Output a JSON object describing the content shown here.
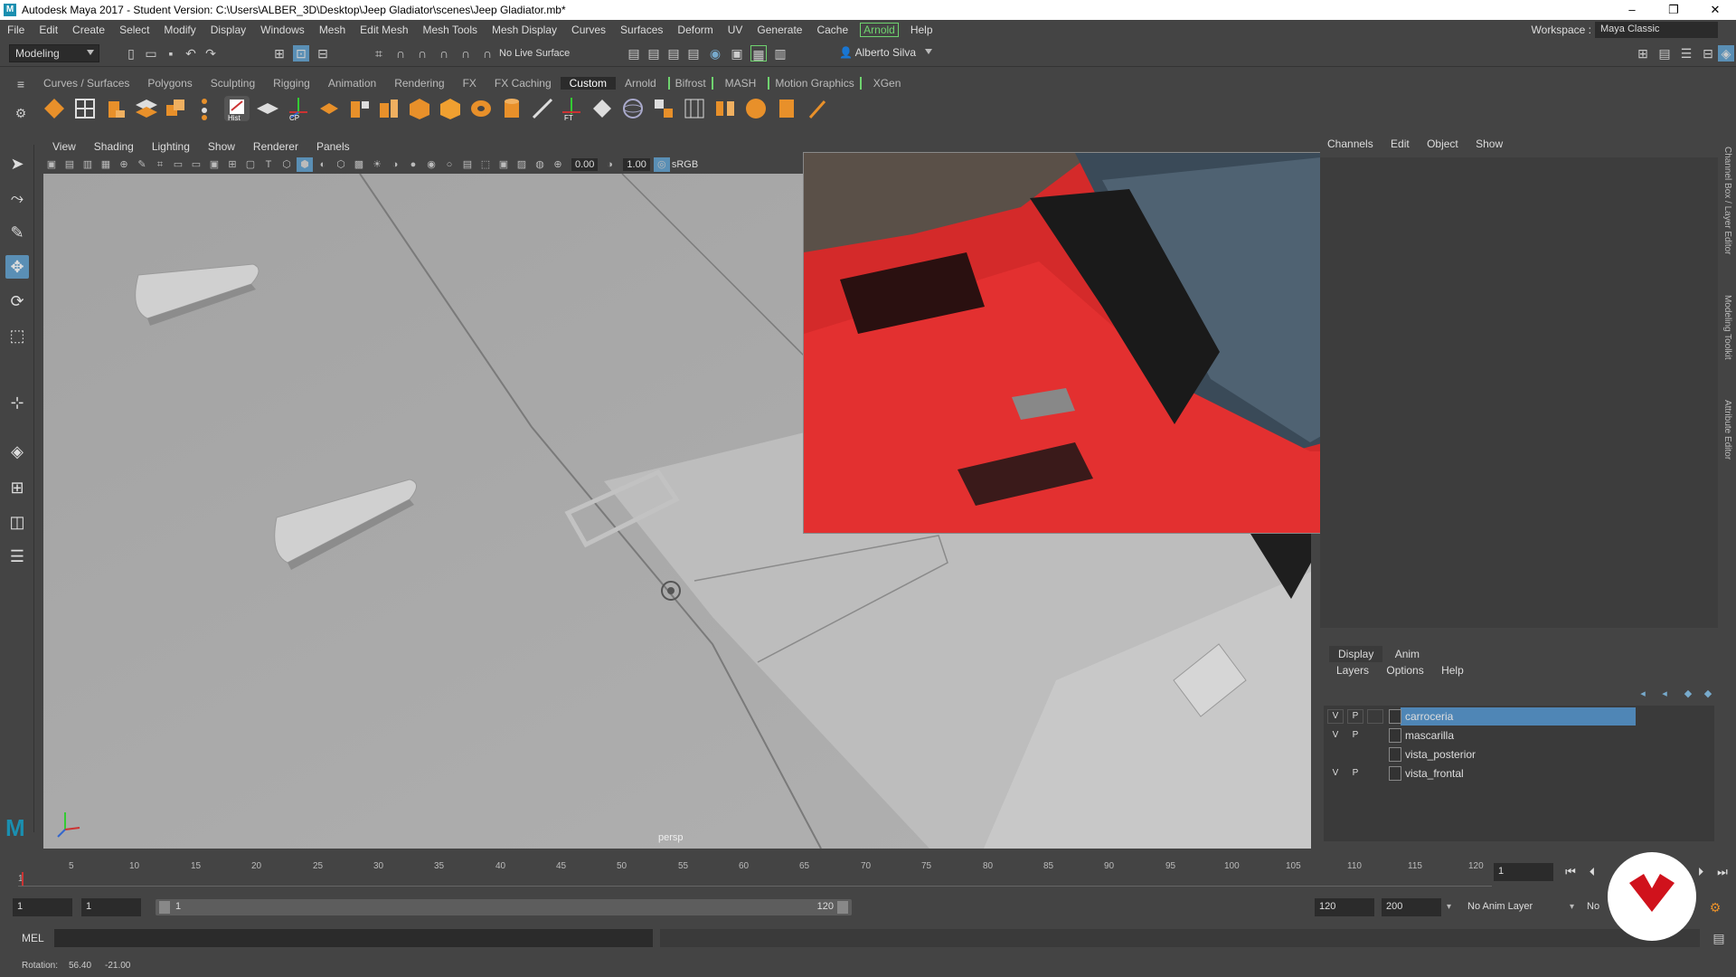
{
  "title_bar": {
    "title": "Autodesk Maya 2017 - Student Version: C:\\Users\\ALBER_3D\\Desktop\\Jeep Gladiator\\scenes\\Jeep Gladiator.mb*",
    "minimize": "–",
    "maximize": "❐",
    "close": "✕"
  },
  "menu": {
    "items": [
      "File",
      "Edit",
      "Create",
      "Select",
      "Modify",
      "Display",
      "Windows",
      "Mesh",
      "Edit Mesh",
      "Mesh Tools",
      "Mesh Display",
      "Curves",
      "Surfaces",
      "Deform",
      "UV",
      "Generate",
      "Cache"
    ],
    "arnold": "Arnold",
    "help": "Help",
    "workspace_label": "Workspace :",
    "workspace_value": "Maya Classic"
  },
  "status_line": {
    "menu_set": "Modeling",
    "live_surface": "No Live Surface",
    "user": "Alberto Silva"
  },
  "shelf": {
    "tabs": [
      "Curves / Surfaces",
      "Polygons",
      "Sculpting",
      "Rigging",
      "Animation",
      "Rendering",
      "FX",
      "FX Caching",
      "Custom",
      "Arnold",
      "Bifrost",
      "MASH",
      "Motion Graphics",
      "XGen"
    ],
    "active_tab": "Custom",
    "icon_labels": {
      "hist": "Hist",
      "cp": "CP",
      "ft": "FT"
    }
  },
  "viewport": {
    "menus": [
      "View",
      "Shading",
      "Lighting",
      "Show",
      "Renderer",
      "Panels"
    ],
    "exposure": "0.00",
    "gamma": "1.00",
    "color_space": "sRGB",
    "camera_label": "persp"
  },
  "channel_box": {
    "menus": [
      "Channels",
      "Edit",
      "Object",
      "Show"
    ]
  },
  "layer_editor": {
    "tabs": [
      "Display",
      "Anim"
    ],
    "active_tab": "Display",
    "submenus": [
      "Layers",
      "Options",
      "Help"
    ],
    "layers": [
      {
        "v": "V",
        "p": "P",
        "name": "carroceria",
        "selected": true
      },
      {
        "v": "V",
        "p": "P",
        "name": "mascarilla",
        "selected": false
      },
      {
        "v": "",
        "p": "",
        "name": "vista_posterior",
        "selected": false
      },
      {
        "v": "V",
        "p": "P",
        "name": "vista_frontal",
        "selected": false
      }
    ]
  },
  "side_tabs": [
    "Channel Box / Layer Editor",
    "Modeling Toolkit",
    "Attribute Editor"
  ],
  "time_slider": {
    "ticks": [
      "5",
      "10",
      "15",
      "20",
      "25",
      "30",
      "35",
      "40",
      "45",
      "50",
      "55",
      "60",
      "65",
      "70",
      "75",
      "80",
      "85",
      "90",
      "95",
      "100",
      "105",
      "110",
      "115",
      "120"
    ],
    "first_frame": "1",
    "current_frame": "1"
  },
  "range_slider": {
    "start": "1",
    "playback_start": "1",
    "range_start_label": "1",
    "range_end_label": "120",
    "playback_end": "120",
    "end": "200",
    "anim_layer": "No Anim Layer",
    "char_set": "No"
  },
  "command_line": {
    "label": "MEL"
  },
  "help_line": {
    "label": "Rotation:",
    "value1": "56.40",
    "value2": "-21.00"
  },
  "colors": {
    "accent": "#5a8fb5",
    "arnold_green": "#6fd36f",
    "car_red": "#d42a2a",
    "viewport_grey": "#a7a7a7"
  }
}
